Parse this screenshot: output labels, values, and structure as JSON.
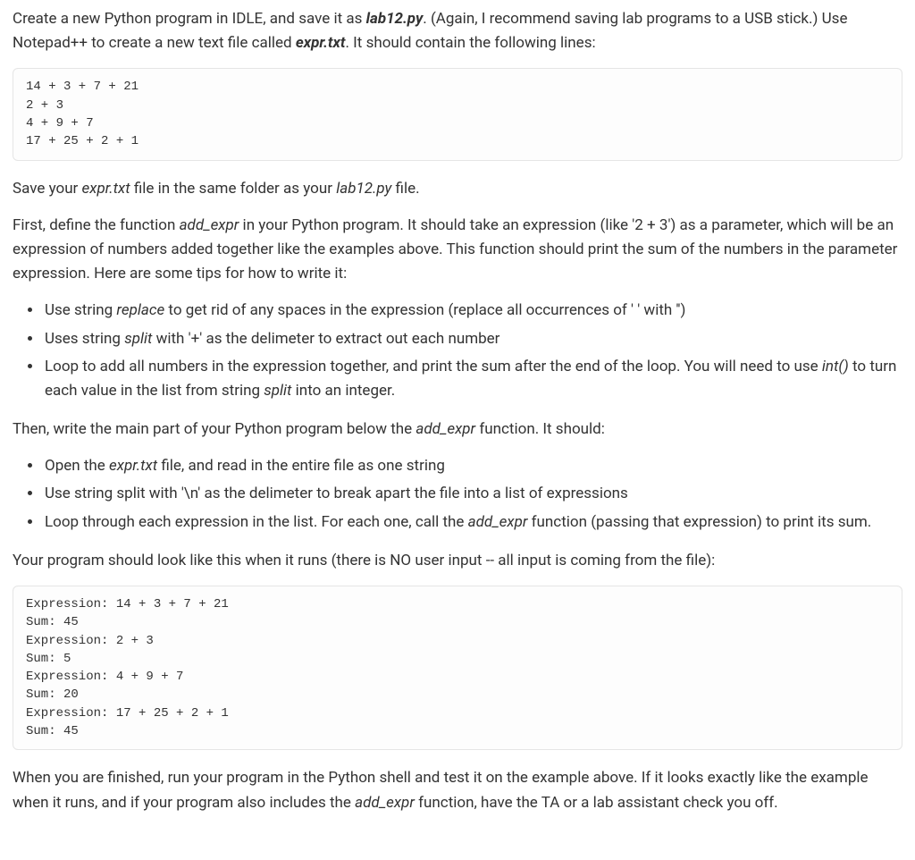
{
  "para1": {
    "a": "Create a new Python program in IDLE, and save it as ",
    "file1": "lab12.py",
    "b": ". (Again, I recommend saving lab programs to a USB stick.) Use Notepad++ to create a new text file called ",
    "file2": "expr.txt",
    "c": ". It should contain the following lines:"
  },
  "code1": "14 + 3 + 7 + 21\n2 + 3\n4 + 9 + 7\n17 + 25 + 2 + 1",
  "para2": {
    "a": "Save your ",
    "file1": "expr.txt",
    "b": " file in the same folder as your ",
    "file2": "lab12.py",
    "c": " file."
  },
  "para3": {
    "a": "First, define the function ",
    "fn": "add_expr",
    "b": " in your Python program. It should take an expression (like '2 + 3') as a parameter, which will be an expression of numbers added together like the examples above. This function should print the sum of the numbers in the parameter expression. Here are some tips for how to write it:"
  },
  "list1": {
    "i1a": "Use string ",
    "i1b": "replace",
    "i1c": " to get rid of any spaces in the expression (replace all occurrences of ' ' with '')",
    "i2a": "Uses string ",
    "i2b": "split",
    "i2c": " with '+' as the delimeter to extract out each number",
    "i3a": "Loop to add all numbers in the expression together, and print the sum after the end of the loop. You will need to use ",
    "i3b": "int()",
    "i3c": " to turn each value in the list from string ",
    "i3d": "split",
    "i3e": " into an integer."
  },
  "para4": {
    "a": "Then, write the main part of your Python program below the ",
    "fn": "add_expr",
    "b": " function. It should:"
  },
  "list2": {
    "i1a": "Open the ",
    "i1b": "expr.txt",
    "i1c": " file, and read in the entire file as one string",
    "i2": "Use string split with '\\n' as the delimeter to break apart the file into a list of expressions",
    "i3a": "Loop through each expression in the list. For each one, call the ",
    "i3b": "add_expr",
    "i3c": " function (passing that expression) to print its sum."
  },
  "para5": "Your program should look like this when it runs (there is NO user input -- all input is coming from the file):",
  "code2": "Expression: 14 + 3 + 7 + 21\nSum: 45\nExpression: 2 + 3\nSum: 5\nExpression: 4 + 9 + 7\nSum: 20\nExpression: 17 + 25 + 2 + 1\nSum: 45",
  "para6": {
    "a": "When you are finished, run your program in the Python shell and test it on the example above. If it looks exactly like the example when it runs, and if your program also includes the ",
    "fn": "add_expr",
    "b": " function, have the TA or a lab assistant check you off."
  }
}
